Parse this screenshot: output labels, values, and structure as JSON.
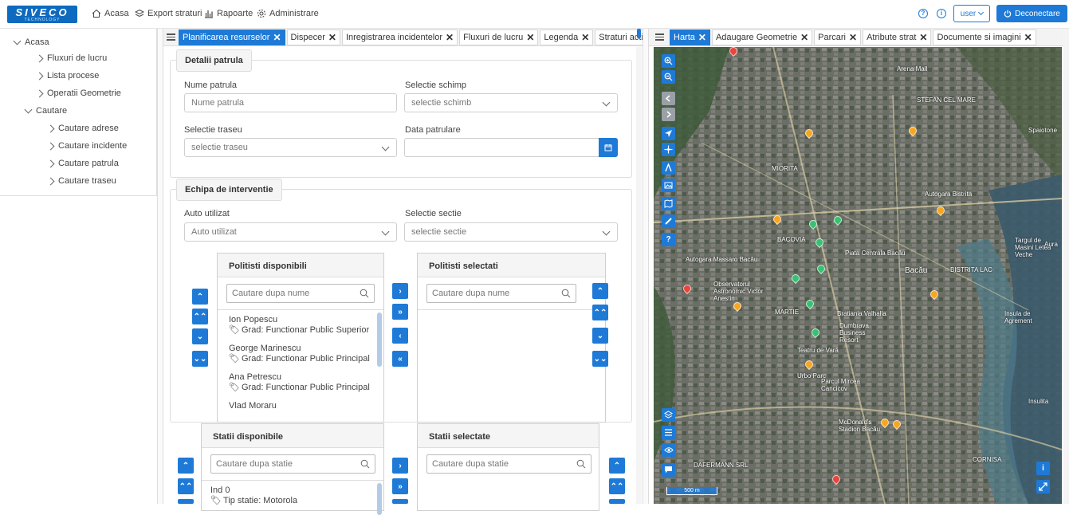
{
  "brand": {
    "logo_text": "SIVECO",
    "logo_sub": "TECHNOLOGY"
  },
  "nav": {
    "home": "Acasa",
    "export": "Export straturi",
    "reports": "Rapoarte",
    "admin": "Administrare"
  },
  "user": {
    "name": "user",
    "logout": "Deconectare"
  },
  "sidebar": {
    "items": [
      {
        "label": "Acasa"
      },
      {
        "label": "Fluxuri de lucru"
      },
      {
        "label": "Lista procese"
      },
      {
        "label": "Operatii Geometrie"
      },
      {
        "label": "Cautare"
      },
      {
        "label": "Cautare adrese"
      },
      {
        "label": "Cautare incidente"
      },
      {
        "label": "Cautare patrula"
      },
      {
        "label": "Cautare traseu"
      }
    ]
  },
  "center_tabs": [
    "Planificarea resurselor",
    "Dispecer",
    "Inregistrarea incidentelor",
    "Fluxuri de lucru",
    "Legenda",
    "Straturi active"
  ],
  "right_tabs": [
    "Harta",
    "Adaugare Geometrie",
    "Parcari",
    "Atribute strat",
    "Documente si imagini"
  ],
  "patrol": {
    "legend": "Detalii patrula",
    "name_label": "Nume patrula",
    "name_placeholder": "Nume patrula",
    "shift_label": "Selectie schimp",
    "shift_value": "selectie schimb",
    "route_label": "Selectie traseu",
    "route_value": "selectie traseu",
    "date_label": "Data patrulare",
    "date_value": ""
  },
  "team": {
    "legend": "Echipa de interventie",
    "vehicle_label": "Auto utilizat",
    "vehicle_value": "Auto utilizat",
    "section_label": "Selectie sectie",
    "section_value": "selectie sectie",
    "available_title": "Politisti disponibili",
    "selected_title": "Politisti selectati",
    "search_placeholder": "Cautare dupa nume",
    "officers": [
      {
        "name": "Ion Popescu",
        "rank": "Grad: Functionar Public Superior"
      },
      {
        "name": "George Marinescu",
        "rank": "Grad: Functionar Public Principal"
      },
      {
        "name": "Ana Petrescu",
        "rank": "Grad: Functionar Public Principal"
      },
      {
        "name": "Vlad Moraru",
        "rank": ""
      }
    ]
  },
  "stations": {
    "available_title": "Statii disponibile",
    "selected_title": "Statii selectate",
    "search_placeholder": "Cautare dupa statie",
    "items": [
      {
        "name": "Ind 0",
        "type": "Tip statie: Motorola"
      }
    ]
  },
  "map": {
    "scale": "500 m",
    "labels": [
      "Arena Mall",
      "STEFAN CEL MARE",
      "Spaiotone",
      "MIORITA",
      "BACOVIA",
      "Bacău",
      "BISTRITA LAC",
      "MARTIE",
      "Teatru de Vară",
      "Parcul Mircea Cancicov",
      "Autogara Bistrita",
      "Targul de Masini Letea Veche",
      "Insula de Agrement",
      "Insulita",
      "Aura",
      "McDonald's Stadion Bacău",
      "DAFERMANN SRL",
      "CORNISA",
      "Observatorul Astronomic Victor Anestin",
      "Dumbrava Business Resort",
      "Urbo Parc",
      "Autogara Massaro Bacău",
      "Piata Centrala Bacău",
      "Bratiania Valhalla"
    ]
  },
  "colors": {
    "accent": "#1e7ad6"
  }
}
